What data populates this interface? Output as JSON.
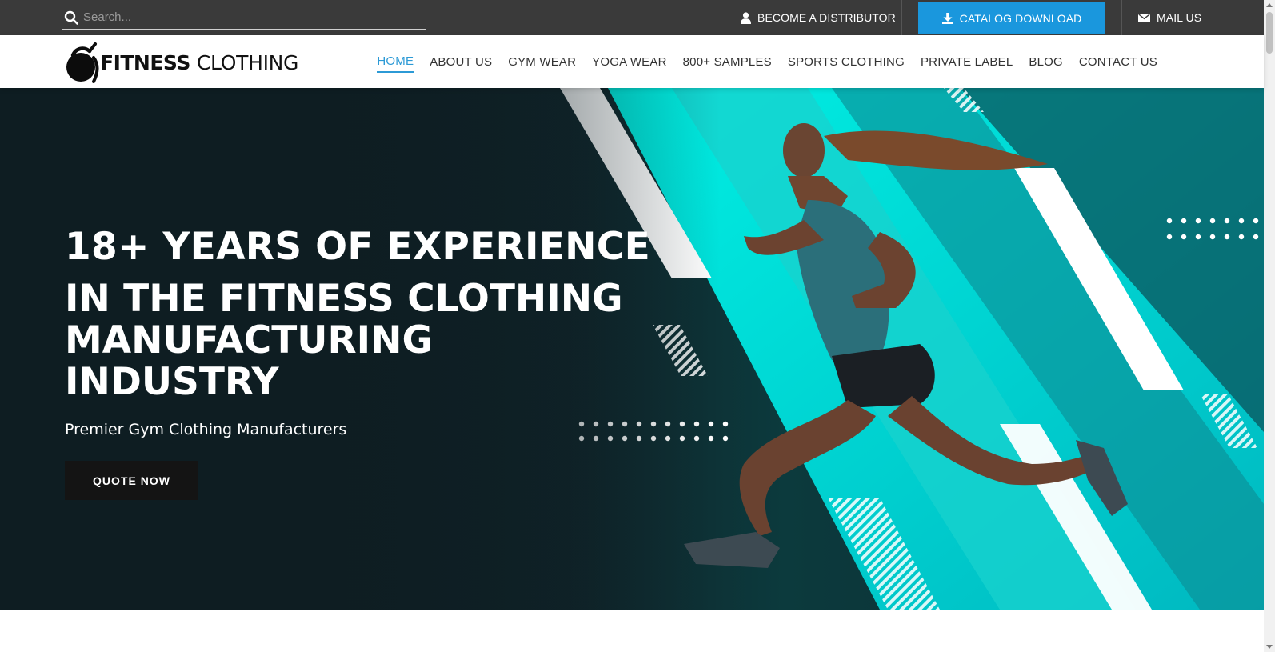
{
  "topbar": {
    "search_placeholder": "Search...",
    "distributor_label": "BECOME A DISTRIBUTOR",
    "catalog_label": "CATALOG DOWNLOAD",
    "mail_label": "MAIL US",
    "background_color": "#3a3a3a",
    "catalog_color": "#1a97dd"
  },
  "header": {
    "logo_bold": "FITNESS",
    "logo_regular": "CLOTHING",
    "nav": [
      {
        "label": "HOME",
        "active": true
      },
      {
        "label": "ABOUT US"
      },
      {
        "label": "GYM WEAR"
      },
      {
        "label": "YOGA WEAR"
      },
      {
        "label": "800+ SAMPLES"
      },
      {
        "label": "SPORTS CLOTHING"
      },
      {
        "label": "PRIVATE LABEL"
      },
      {
        "label": "BLOG"
      },
      {
        "label": "CONTACT US"
      }
    ],
    "active_color": "#2c9ad6"
  },
  "hero": {
    "headline_1": "18+ YEARS OF EXPERIENCE",
    "headline_2": "IN THE FITNESS CLOTHING MANUFACTURING INDUSTRY",
    "subheadline": "Premier Gym Clothing Manufacturers",
    "cta_label": "QUOTE NOW",
    "accent_color": "#00e0d8"
  }
}
